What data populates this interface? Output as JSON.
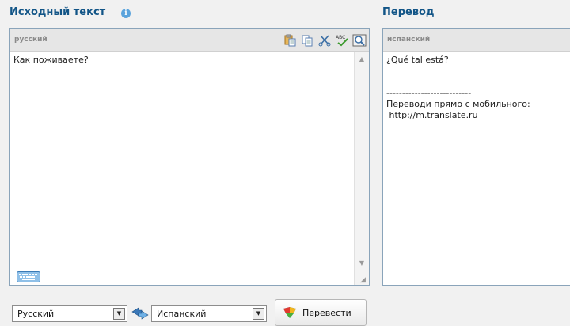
{
  "source": {
    "title": "Исходный текст",
    "language_label": "русский",
    "text": "Как поживаете?",
    "tools": [
      "paste-icon",
      "copy-icon",
      "cut-icon",
      "spellcheck-icon",
      "zoom-icon"
    ]
  },
  "output": {
    "title": "Перевод",
    "language_label": "испанский",
    "text": "¿Qué tal está?\n\n\n---------------------------\nПереводи прямо с мобильного:\n http://m.translate.ru"
  },
  "controls": {
    "source_language": "Русский",
    "target_language": "Испанский",
    "translate_label": "Перевести"
  },
  "colors": {
    "title": "#125587",
    "panel_border": "#8aa4ba",
    "header_bg": "#e6e6e6",
    "page_bg": "#f1f1f1"
  }
}
